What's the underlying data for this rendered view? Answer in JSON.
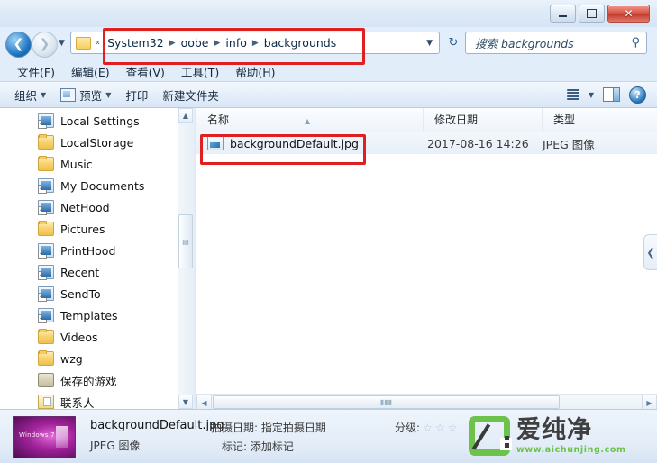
{
  "window": {
    "minimize_label": "",
    "restore_label": "",
    "close_label": "✕"
  },
  "nav": {
    "back_glyph": "❮",
    "forward_glyph": "❯",
    "recent_dropdown_glyph": "▼",
    "address_overflow_glyph": "«",
    "address_dropdown_glyph": "▼",
    "refresh_glyph": "↻",
    "breadcrumbs": [
      "System32",
      "oobe",
      "info",
      "backgrounds"
    ],
    "separator": "▶"
  },
  "search": {
    "placeholder": "搜索 backgrounds",
    "icon_glyph": "🔍"
  },
  "menubar": {
    "items": [
      {
        "label": "文件(F)"
      },
      {
        "label": "编辑(E)"
      },
      {
        "label": "查看(V)"
      },
      {
        "label": "工具(T)"
      },
      {
        "label": "帮助(H)"
      }
    ]
  },
  "toolbar": {
    "organize_label": "组织",
    "organize_caret": "▼",
    "preview_label": "预览",
    "preview_caret": "▼",
    "print_label": "打印",
    "new_folder_label": "新建文件夹",
    "views_caret": "▼",
    "help_label": "?"
  },
  "navpane": {
    "scroll_up_glyph": "▲",
    "scroll_down_glyph": "▼",
    "thumb_grip": "▤",
    "items": [
      {
        "label": "Local Settings",
        "icon": "system-shortcut-icon"
      },
      {
        "label": "LocalStorage",
        "icon": "folder-icon"
      },
      {
        "label": "Music",
        "icon": "folder-icon"
      },
      {
        "label": "My Documents",
        "icon": "system-shortcut-icon"
      },
      {
        "label": "NetHood",
        "icon": "system-shortcut-icon"
      },
      {
        "label": "Pictures",
        "icon": "folder-icon"
      },
      {
        "label": "PrintHood",
        "icon": "system-shortcut-icon"
      },
      {
        "label": "Recent",
        "icon": "system-shortcut-icon"
      },
      {
        "label": "SendTo",
        "icon": "system-shortcut-icon"
      },
      {
        "label": "Templates",
        "icon": "system-shortcut-icon"
      },
      {
        "label": "Videos",
        "icon": "folder-icon"
      },
      {
        "label": "wzg",
        "icon": "folder-icon"
      },
      {
        "label": "保存的游戏",
        "icon": "saved-games-icon"
      },
      {
        "label": "联系人",
        "icon": "contacts-icon"
      }
    ]
  },
  "filelist": {
    "columns": [
      {
        "label": "名称"
      },
      {
        "label": "修改日期"
      },
      {
        "label": "类型"
      }
    ],
    "sort_caret": "▲",
    "rows": [
      {
        "name": "backgroundDefault.jpg",
        "date": "2017-08-16 14:26",
        "type": "JPEG 图像",
        "icon": "jpeg-file-icon"
      }
    ],
    "hscroll_left_glyph": "◀",
    "hscroll_right_glyph": "▶",
    "hscroll_grip": "▮▮▮",
    "collapse_glyph": "❮"
  },
  "details": {
    "file_name": "backgroundDefault.jpg",
    "file_type": "JPEG 图像",
    "shot_date": "拍摄日期: 指定拍摄日期",
    "tags": "标记: 添加标记",
    "rating_label": "分级:",
    "stars": [
      "☆",
      "☆",
      "☆"
    ],
    "thumbnail_caption": "Windows 7"
  },
  "watermark": {
    "brand": "爱纯净",
    "url": "www.aichunjing.com",
    "color": "#6cc24a"
  },
  "annotations": {
    "address_highlight": "breadcrumb-path-highlight",
    "file_highlight": "selected-file-highlight",
    "color": "#e02020"
  }
}
